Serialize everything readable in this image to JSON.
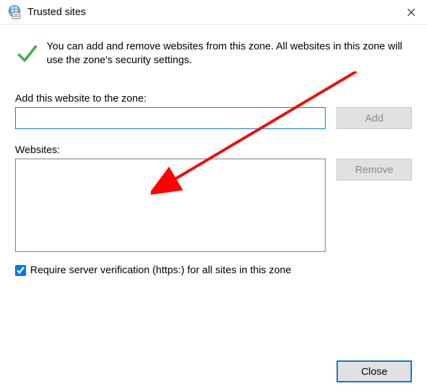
{
  "titlebar": {
    "title": "Trusted sites"
  },
  "info": {
    "text": "You can add and remove websites from this zone. All websites in this zone will use the zone's security settings."
  },
  "add_section": {
    "label": "Add this website to the zone:",
    "input_value": "",
    "add_button": "Add"
  },
  "websites_section": {
    "label": "Websites:",
    "remove_button": "Remove"
  },
  "checkbox": {
    "label": "Require server verification (https:) for all sites in this zone",
    "checked": true
  },
  "footer": {
    "close_button": "Close"
  }
}
